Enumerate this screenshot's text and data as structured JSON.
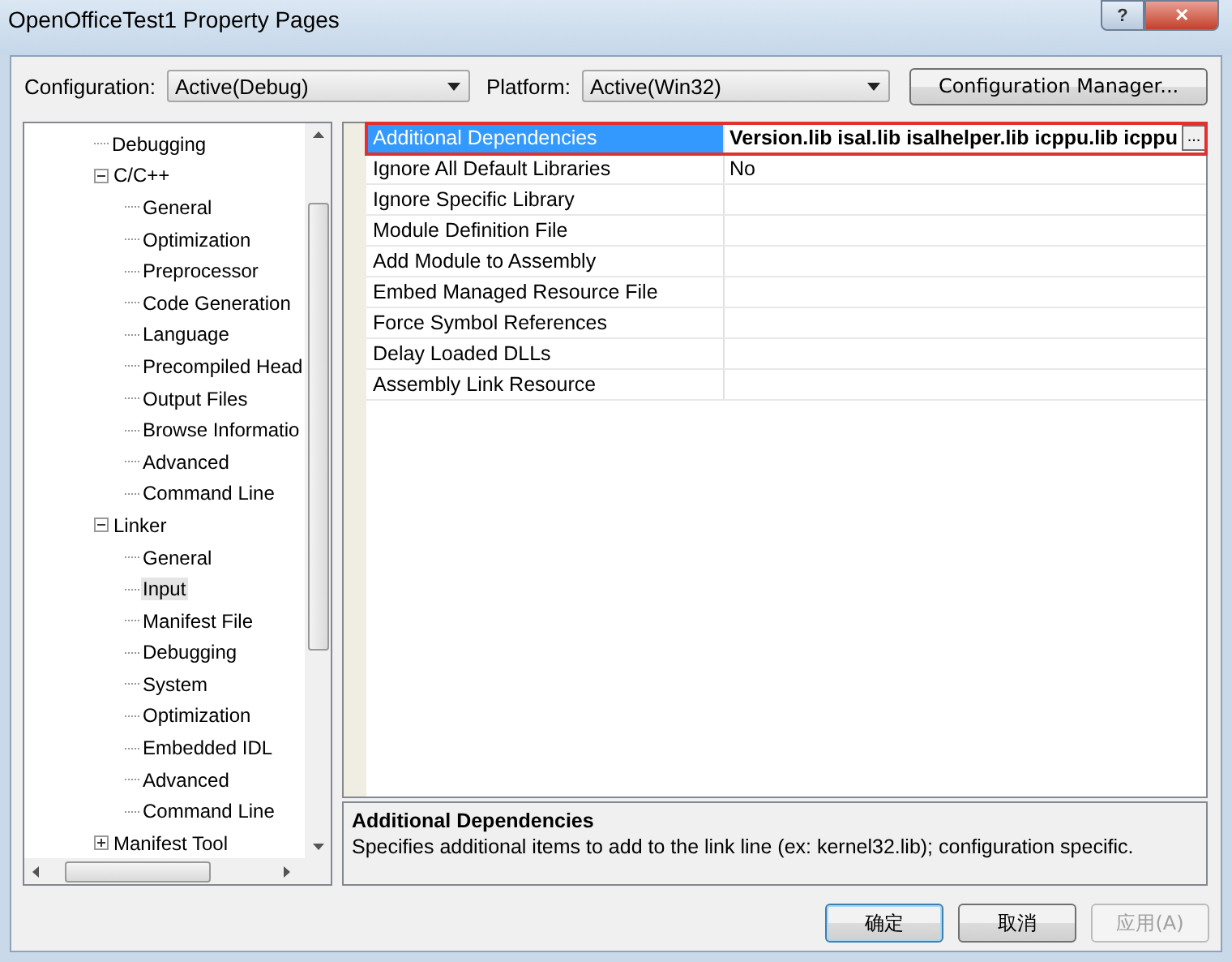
{
  "window": {
    "title": "OpenOfficeTest1 Property Pages",
    "buttons": [
      {
        "kind": "help",
        "label": "?"
      },
      {
        "kind": "close",
        "label": "✕"
      }
    ]
  },
  "configuration": {
    "label": "Configuration:",
    "value": "Active(Debug)"
  },
  "platform": {
    "label": "Platform:",
    "value": "Active(Win32)"
  },
  "config_manager_button": "Configuration Manager...",
  "tree": {
    "items": [
      {
        "label": "Debugging",
        "selected": false
      },
      {
        "label": "C/C++",
        "selected": false,
        "expanded": true,
        "children": [
          {
            "label": "General",
            "selected": false
          },
          {
            "label": "Optimization",
            "selected": false
          },
          {
            "label": "Preprocessor",
            "selected": false
          },
          {
            "label": "Code Generation",
            "selected": false
          },
          {
            "label": "Language",
            "selected": false
          },
          {
            "label": "Precompiled Head",
            "selected": false
          },
          {
            "label": "Output Files",
            "selected": false
          },
          {
            "label": "Browse Informatio",
            "selected": false
          },
          {
            "label": "Advanced",
            "selected": false
          },
          {
            "label": "Command Line",
            "selected": false
          }
        ]
      },
      {
        "label": "Linker",
        "selected": false,
        "expanded": true,
        "children": [
          {
            "label": "General",
            "selected": false
          },
          {
            "label": "Input",
            "selected": true
          },
          {
            "label": "Manifest File",
            "selected": false
          },
          {
            "label": "Debugging",
            "selected": false
          },
          {
            "label": "System",
            "selected": false
          },
          {
            "label": "Optimization",
            "selected": false
          },
          {
            "label": "Embedded IDL",
            "selected": false
          },
          {
            "label": "Advanced",
            "selected": false
          },
          {
            "label": "Command Line",
            "selected": false
          }
        ]
      },
      {
        "label": "Manifest Tool",
        "selected": false,
        "expanded": false
      }
    ]
  },
  "properties": {
    "rows": [
      {
        "name": "Additional Dependencies",
        "value": "Version.lib isal.lib isalhelper.lib icppu.lib icppu",
        "selected": true,
        "modified": true,
        "outlined": true,
        "edit_button": "..."
      },
      {
        "name": "Ignore All Default Libraries",
        "value": "No",
        "selected": false,
        "modified": false,
        "outlined": false
      },
      {
        "name": "Ignore Specific Library",
        "selected": false,
        "outlined": false
      },
      {
        "name": "Module Definition File",
        "selected": false,
        "outlined": false
      },
      {
        "name": "Add Module to Assembly",
        "selected": false,
        "outlined": false
      },
      {
        "name": "Embed Managed Resource File",
        "selected": false,
        "outlined": false
      },
      {
        "name": "Force Symbol References",
        "selected": false,
        "outlined": false
      },
      {
        "name": "Delay Loaded DLLs",
        "selected": false,
        "outlined": false
      },
      {
        "name": "Assembly Link Resource",
        "selected": false,
        "outlined": false
      }
    ]
  },
  "description": {
    "title": "Additional Dependencies",
    "text": "Specifies additional items to add to the link line (ex: kernel32.lib); configuration specific."
  },
  "buttons": [
    {
      "label": "确定",
      "default": true,
      "disabled": false
    },
    {
      "label": "取消",
      "default": false,
      "disabled": false
    },
    {
      "label": "应用(A)",
      "default": false,
      "disabled": true
    }
  ]
}
